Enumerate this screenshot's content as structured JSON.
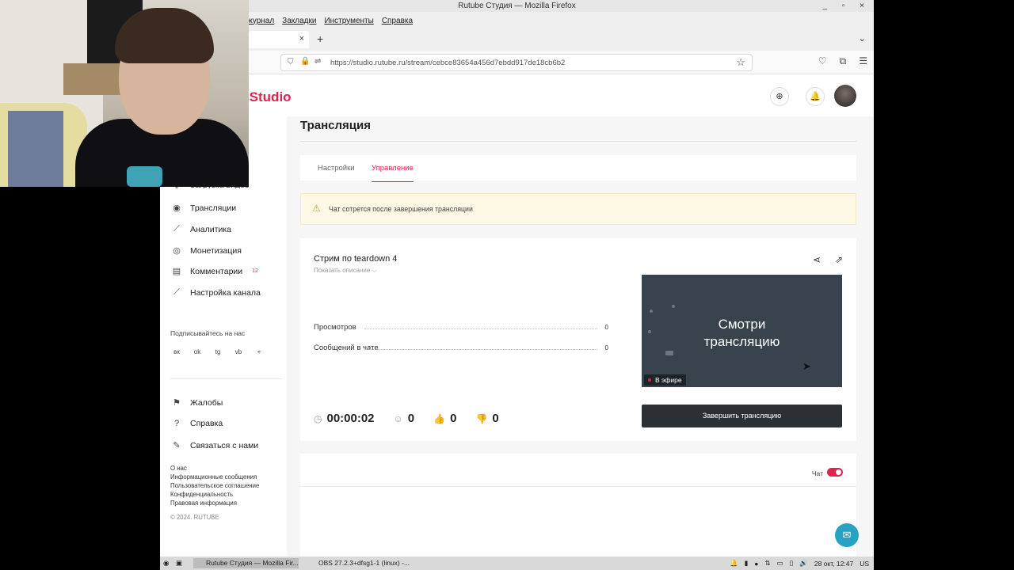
{
  "window": {
    "title": "Rutube Студия — Mozilla Firefox",
    "controls": "_ ▫ ×"
  },
  "menu": [
    "журнал",
    "Закладки",
    "Инструменты",
    "Справка"
  ],
  "tabs_bar": {
    "close": "×",
    "new_tab": "+",
    "list": "⌄"
  },
  "address": {
    "url": "https://studio.rutube.ru/stream/cebce83654a456d7ebdd917de18cb6b2"
  },
  "header": {
    "brand": "Studio"
  },
  "sidebar": {
    "items": [
      {
        "label": "Загрузка видео",
        "icon": "upload-icon"
      },
      {
        "label": "Трансляции",
        "icon": "broadcast-icon"
      },
      {
        "label": "Аналитика",
        "icon": "chart-icon"
      },
      {
        "label": "Монетизация",
        "icon": "coin-icon"
      },
      {
        "label": "Комментарии",
        "icon": "comment-icon",
        "badge": "12"
      },
      {
        "label": "Настройка канала",
        "icon": "wand-icon"
      }
    ],
    "subscribe_label": "Подписывайтесь на нас",
    "social": [
      "вк",
      "ok",
      "tg",
      "vb",
      "+"
    ],
    "bottom_items": [
      {
        "label": "Жалобы",
        "icon": "flag-icon"
      },
      {
        "label": "Справка",
        "icon": "help-icon"
      },
      {
        "label": "Связаться с нами",
        "icon": "pen-icon"
      }
    ],
    "links": [
      "О нас",
      "Информационные сообщения",
      "Пользовательское соглашение",
      "Конфиденциальность",
      "Правовая информация"
    ],
    "copyright": "© 2024. RUTUBE"
  },
  "main": {
    "title": "Трансляция",
    "tabs": [
      {
        "label": "Настройки",
        "active": false
      },
      {
        "label": "Управление",
        "active": true
      }
    ],
    "notice": "Чат сотрется после завершения трансляции",
    "stream": {
      "title": "Стрим по teardown 4",
      "show_description": "Показать описание ⌵",
      "stats": [
        {
          "label": "Просмотров",
          "value": "0"
        },
        {
          "label": "Сообщений в чате",
          "value": "0"
        }
      ],
      "preview_text_line1": "Смотри",
      "preview_text_line2": "трансляцию",
      "live_badge": "В эфире",
      "end_button": "Завершить трансляцию",
      "timer": "00:00:02",
      "viewers": "0",
      "likes": "0",
      "dislikes": "0"
    },
    "chat_label": "Чат",
    "chat_enabled": true
  },
  "taskbar": {
    "apps": [
      {
        "label": "Rutube Студия — Mozilla Fir...",
        "active": true
      },
      {
        "label": "OBS 27.2.3+dfsg1-1 (linux) -...",
        "active": false
      }
    ],
    "clock": "28 окт, 12:47",
    "layout": "US"
  },
  "colors": {
    "accent": "#e0234e",
    "notice_bg": "#fdf9e4",
    "end_button": "#2b3035",
    "preview_bg": "#38434e",
    "support": "#27a2c2"
  }
}
